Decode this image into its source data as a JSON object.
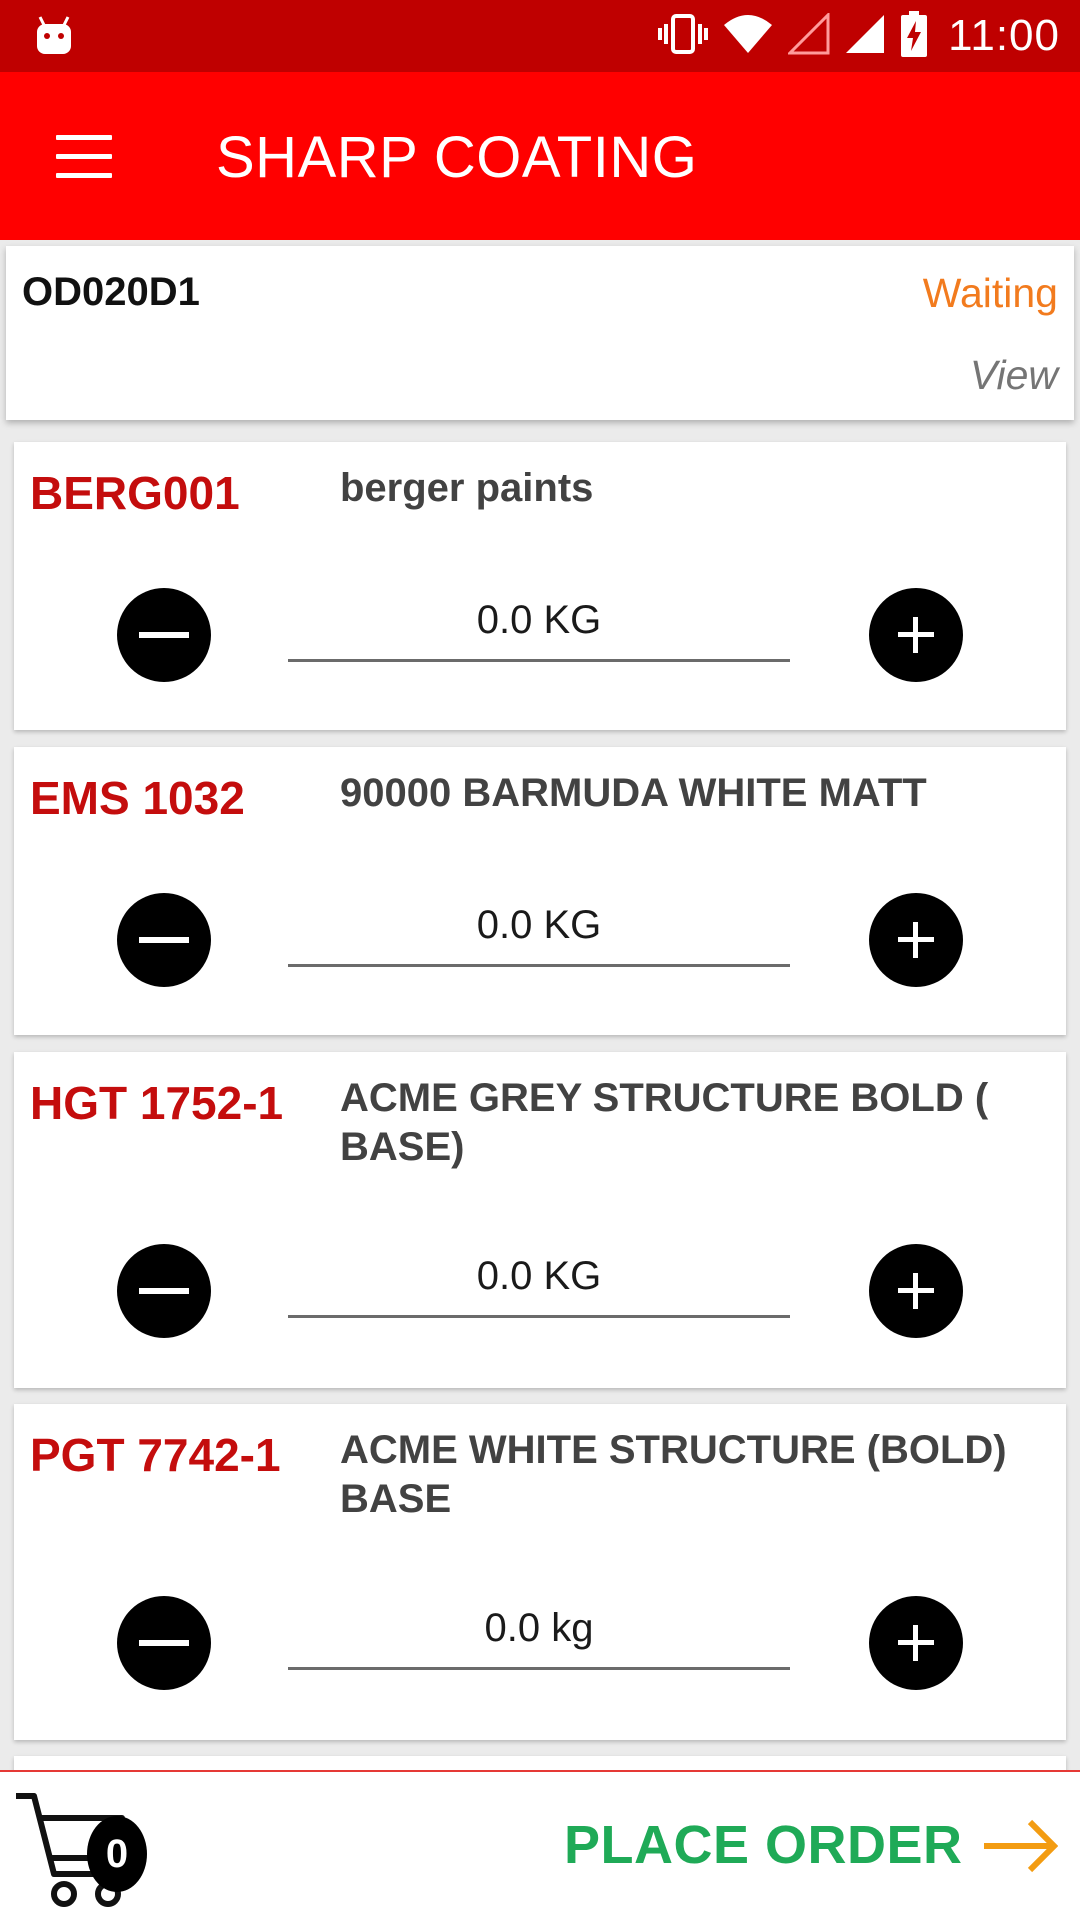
{
  "status_bar": {
    "time": "11:00",
    "icons": [
      "android-icon",
      "vibrate-icon",
      "wifi-icon",
      "no-signal-icon",
      "signal-icon",
      "battery-charging-icon"
    ]
  },
  "toolbar": {
    "title": "SHARP COATING",
    "menu_icon": "hamburger-menu-icon"
  },
  "order": {
    "id": "OD020D1",
    "status": "Waiting",
    "view_label": "View"
  },
  "products": [
    {
      "code": "BERG001",
      "name": "berger paints",
      "quantity": "0.0 KG"
    },
    {
      "code": "EMS 1032",
      "name": "90000 BARMUDA WHITE MATT",
      "quantity": "0.0 KG"
    },
    {
      "code": "HGT 1752-1",
      "name": "ACME GREY STRUCTURE BOLD ( BASE)",
      "quantity": "0.0 KG"
    },
    {
      "code": "PGT 7742-1",
      "name": "ACME WHITE STRUCTURE (BOLD) BASE",
      "quantity": "0.0 kg"
    }
  ],
  "bottom_bar": {
    "cart_count": "0",
    "place_order_label": "PLACE ORDER"
  },
  "colors": {
    "status_bar": "#bf0000",
    "toolbar": "#ff0000",
    "product_code": "#c40d0d",
    "status_waiting": "#f27b1e",
    "place_order": "#1faa57",
    "arrow": "#f39c12"
  }
}
